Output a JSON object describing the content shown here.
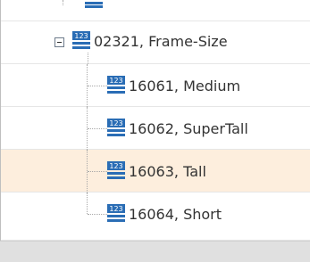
{
  "tree": {
    "parent_label": "02321, Frame-Size",
    "children": [
      {
        "label": "16061, Medium"
      },
      {
        "label": "16062, SuperTall"
      },
      {
        "label": "16063, Tall"
      },
      {
        "label": "16064, Short"
      }
    ],
    "icon_name": "numeric-attribute-icon",
    "icon_text": "123",
    "selected_index": 2,
    "colors": {
      "selected_row": "#fdeedd",
      "icon_blue": "#2a6db5"
    }
  }
}
